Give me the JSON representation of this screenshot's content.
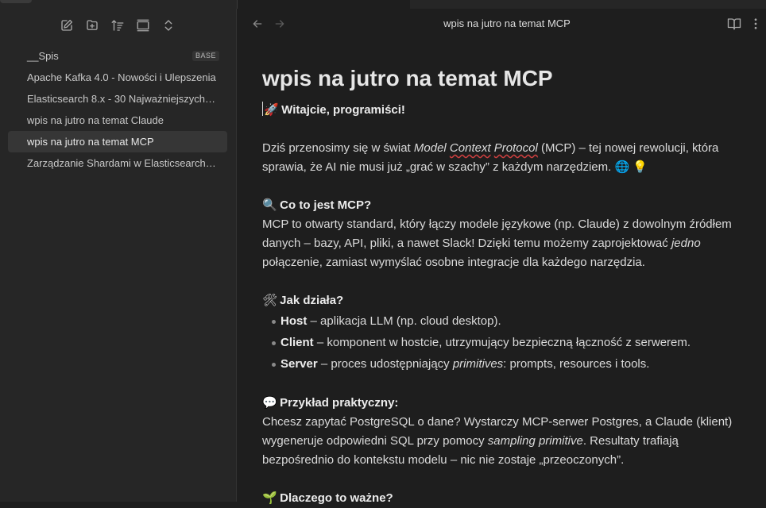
{
  "sidebar": {
    "files": [
      {
        "name": "__Spis",
        "badge": "BASE"
      },
      {
        "name": "Apache Kafka 4.0 - Nowości i Ulepszenia"
      },
      {
        "name": "Elasticsearch 8.x - 30 Najważniejszych N..."
      },
      {
        "name": "wpis na jutro na temat Claude"
      },
      {
        "name": "wpis na jutro na temat MCP"
      },
      {
        "name": "Zarządzanie Shardami w Elasticsearch - ..."
      }
    ]
  },
  "main": {
    "view_title": "wpis na jutro na temat MCP",
    "doc": {
      "title": "wpis na jutro na temat MCP",
      "welcome_emoji": "🚀",
      "welcome": "Witajcie, programiści!",
      "intro_1": "Dziś przenosimy się w świat ",
      "intro_em_1": "Model",
      "intro_em_2": "Context",
      "intro_em_3": "Protocol",
      "intro_2": " (MCP) – tej nowej rewolucji, która sprawia, że AI nie musi już „grać w szachy” z każdym narzędziem.",
      "intro_emoji": "🌐 💡",
      "what_emoji": "🔍",
      "what_heading": "Co to jest MCP?",
      "what_1": "MCP to otwarty standard, który łączy modele językowe (np. Claude) z dowolnym źródłem danych – bazy, API, pliki, a nawet Slack! Dzięki temu możemy zaprojektować ",
      "what_em": "jedno",
      "what_2": " połączenie, zamiast wymyślać osobne integracje dla każdego narzędzia.",
      "how_emoji": "🛠",
      "how_heading": "Jak działa?",
      "how_items": [
        {
          "bold": "Host",
          "text": " – aplikacja LLM (np. cloud desktop)."
        },
        {
          "bold": "Client",
          "text": " – komponent w hostcie, utrzymujący bezpieczną łączność z serwerem."
        },
        {
          "bold": "Server",
          "text": " – proces udostępniający ",
          "em": "primitives",
          "tail": ": prompts, resources i tools."
        }
      ],
      "example_emoji": "💬",
      "example_heading": "Przykład praktyczny:",
      "example_1": "Chcesz zapytać PostgreSQL o dane? Wystarczy MCP-serwer Postgres, a Claude (klient) wygeneruje odpowiedni SQL przy pomocy ",
      "example_em": "sampling primitive",
      "example_2": ". Resultaty trafiają bezpośrednio do kontekstu modelu – nic nie zostaje „przeoczonych”.",
      "why_emoji": "🌱",
      "why_heading": "Dlaczego to ważne?"
    }
  },
  "icons": {
    "toolbar": [
      "new-note-icon",
      "new-folder-icon",
      "sort-icon",
      "collapse-icon",
      "expand-icon"
    ],
    "nav": [
      "back-arrow-icon",
      "forward-arrow-icon"
    ],
    "header": [
      "reading-view-icon",
      "more-options-icon"
    ]
  }
}
